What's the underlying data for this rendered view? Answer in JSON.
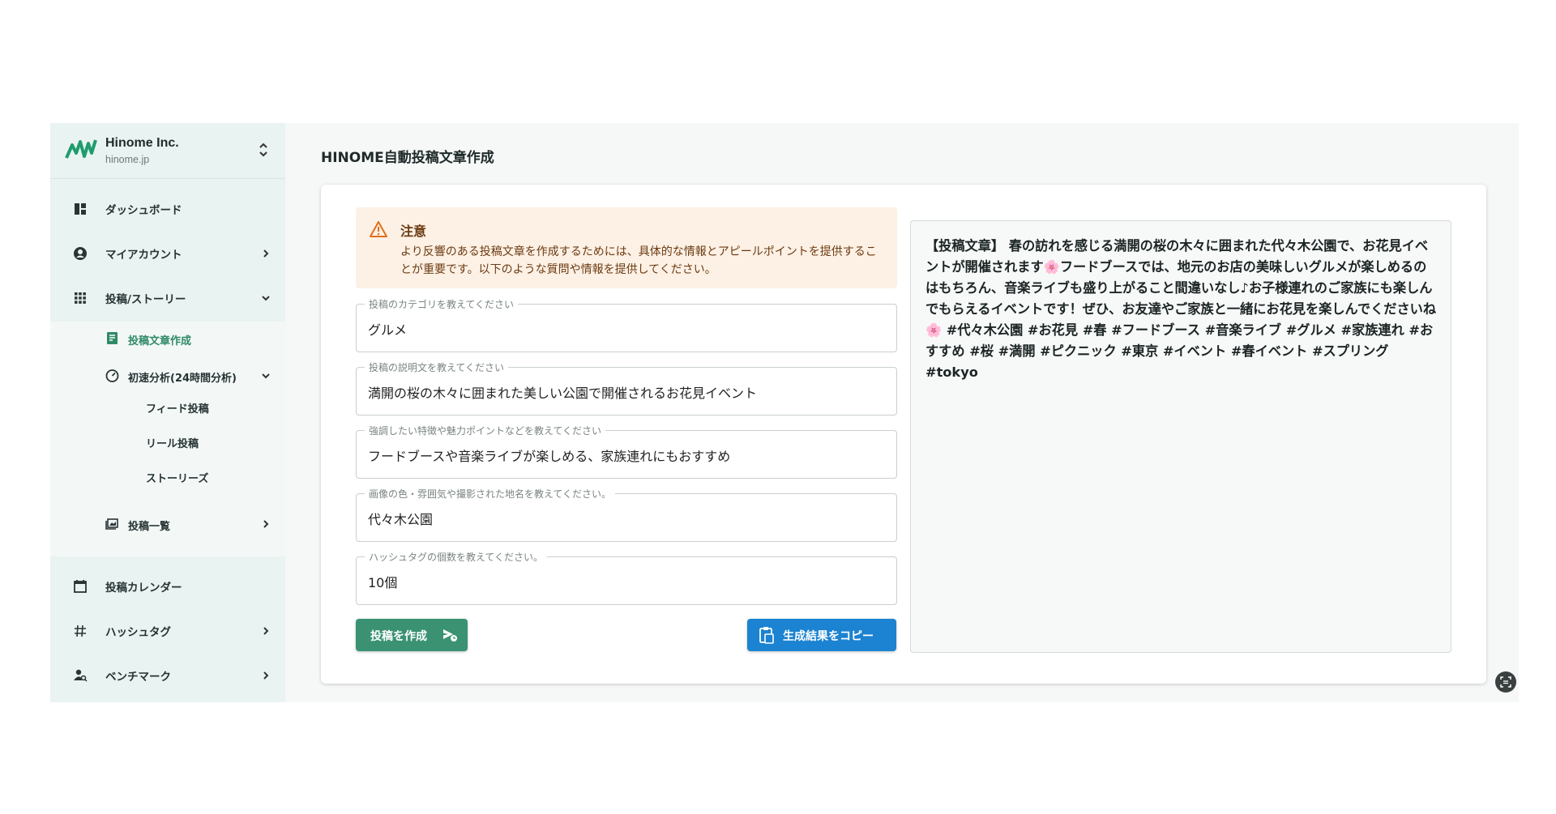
{
  "org": {
    "name": "Hinome Inc.",
    "domain": "hinome.jp"
  },
  "nav": {
    "dashboard": "ダッシュボード",
    "my_account": "マイアカウント",
    "posts_stories": "投稿/ストーリー",
    "post_create": "投稿文章作成",
    "speed_analysis": "初速分析(24時間分析)",
    "feed_post": "フィード投稿",
    "reel_post": "リール投稿",
    "stories": "ストーリーズ",
    "post_list": "投稿一覧",
    "calendar": "投稿カレンダー",
    "hashtag": "ハッシュタグ",
    "benchmark": "ベンチマーク"
  },
  "page": {
    "title": "HINOME自動投稿文章作成"
  },
  "alert": {
    "title": "注意",
    "body": "より反響のある投稿文章を作成するためには、具体的な情報とアピールポイントを提供することが重要です。以下のような質問や情報を提供してください。"
  },
  "fields": [
    {
      "label": "投稿のカテゴリを教えてください",
      "value": "グルメ"
    },
    {
      "label": "投稿の説明文を教えてください",
      "value": "満開の桜の木々に囲まれた美しい公園で開催されるお花見イベント"
    },
    {
      "label": "強調したい特徴や魅力ポイントなどを教えてください",
      "value": "フードブースや音楽ライブが楽しめる、家族連れにもおすすめ"
    },
    {
      "label": "画像の色・雰囲気や撮影された地名を教えてください。",
      "value": "代々木公園"
    },
    {
      "label": "ハッシュタグの個数を教えてください。",
      "value": "10個"
    }
  ],
  "buttons": {
    "create": "投稿を作成",
    "copy": "生成結果をコピー"
  },
  "result": {
    "text": "【投稿文章】 春の訪れを感じる満開の桜の木々に囲まれた代々木公園で、お花見イベントが開催されます🌸フードブースでは、地元のお店の美味しいグルメが楽しめるのはもちろん、音楽ライブも盛り上がること間違いなし♪お子様連れのご家族にも楽しんでもらえるイベントです！ぜひ、お友達やご家族と一緒にお花見を楽しんでくださいね🌸 #代々木公園 #お花見 #春 #フードブース #音楽ライブ #グルメ #家族連れ #おすすめ #桜 #満開 #ピクニック #東京 #イベント #春イベント #スプリング #tokyo"
  },
  "colors": {
    "primary_green": "#3a9273",
    "copy_blue": "#1b83d1",
    "alert_bg": "#fdf0e4",
    "sidebar_bg": "#e9f3f1"
  }
}
